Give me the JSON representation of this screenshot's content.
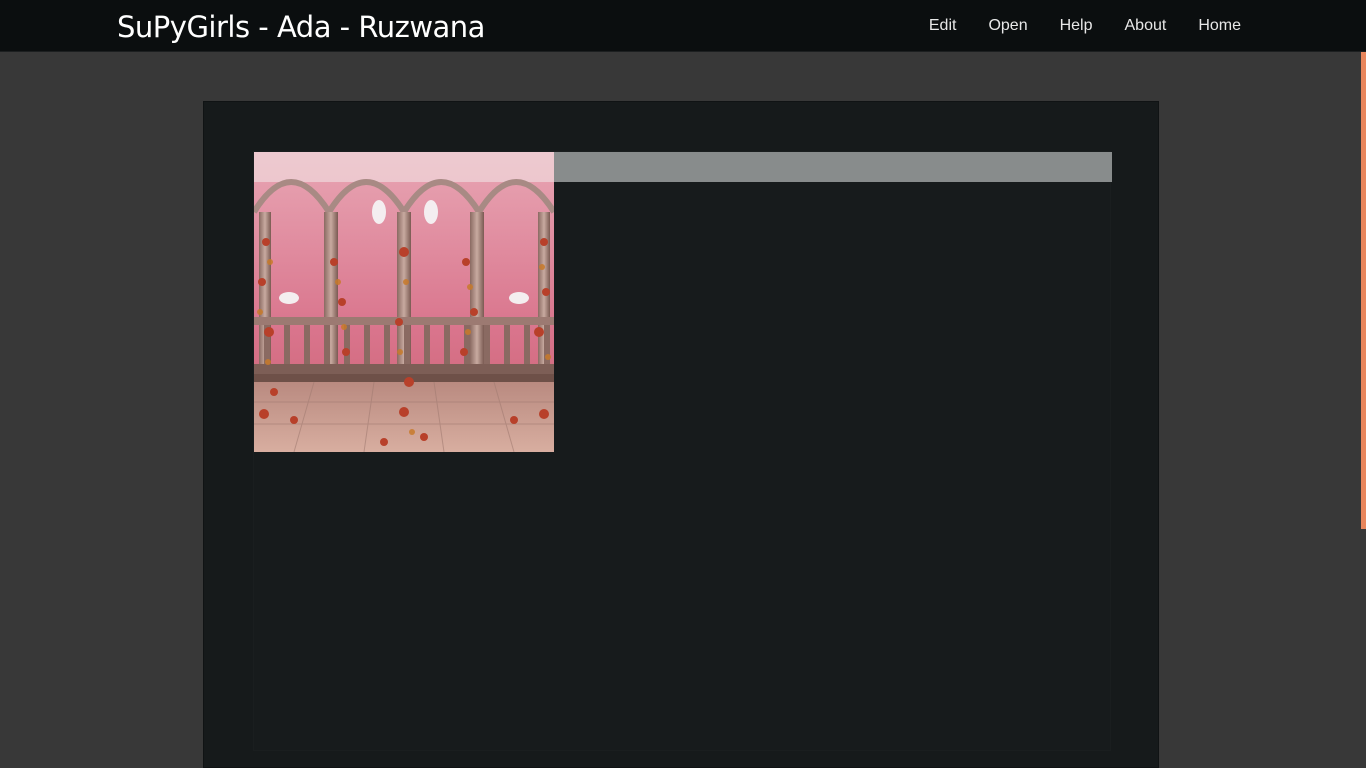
{
  "navbar": {
    "brand": "SuPyGirls - Ada - Ruzwana",
    "items": [
      {
        "label": "Edit"
      },
      {
        "label": "Open"
      },
      {
        "label": "Help"
      },
      {
        "label": "About"
      },
      {
        "label": "Home"
      }
    ]
  },
  "colors": {
    "navbar_bg": "#0b0e0f",
    "page_bg": "#383838",
    "panel_bg": "#161a1b",
    "bar_gray": "#888c8c",
    "scroll_thumb": "#e8865c"
  },
  "main": {
    "image": {
      "icon": "balcony-scene-image"
    }
  }
}
